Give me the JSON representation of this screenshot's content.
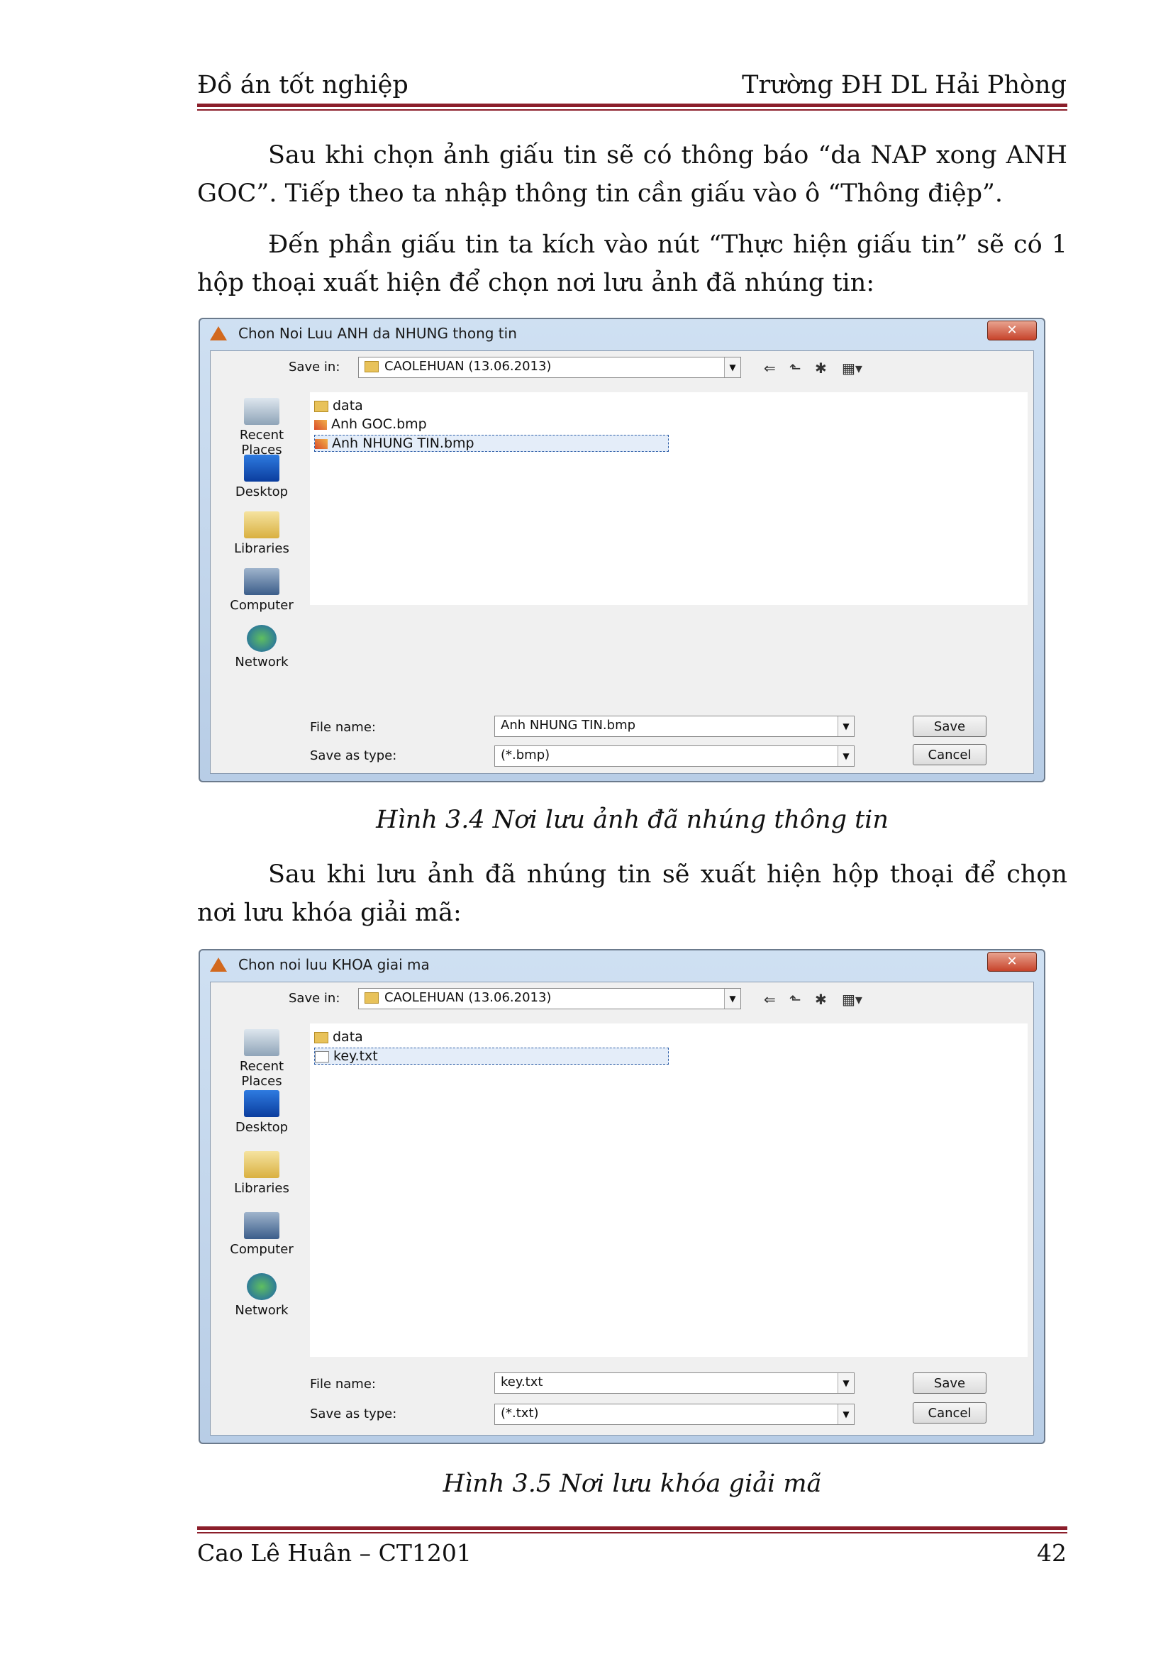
{
  "header": {
    "left": "Đồ án tốt nghiệp",
    "right": "Trường ĐH DL Hải Phòng"
  },
  "paragraphs": {
    "p1": "Sau khi chọn ảnh giấu tin sẽ có thông báo “da NAP xong ANH GOC”. Tiếp theo ta nhập thông tin cần giấu vào ô “Thông điệp”.",
    "p2": "Đến phần giấu tin ta kích vào nút “Thực hiện giấu tin” sẽ có 1 hộp thoại xuất hiện để chọn nơi lưu ảnh đã nhúng tin:",
    "p3": "Sau khi lưu ảnh đã nhúng tin sẽ xuất hiện hộp thoại để chọn nơi lưu khóa giải mã:"
  },
  "dialog1": {
    "title": "Chon Noi Luu ANH da NHUNG thong tin",
    "close": "✕",
    "save_in_label": "Save in:",
    "save_in_value": "CAOLEHUAN (13.06.2013)",
    "places": [
      "Recent Places",
      "Desktop",
      "Libraries",
      "Computer",
      "Network"
    ],
    "files": [
      "data",
      "Anh GOC.bmp",
      "Anh NHUNG TIN.bmp"
    ],
    "file_name_label": "File name:",
    "file_name_value": "Anh NHUNG TIN.bmp",
    "save_type_label": "Save as type:",
    "save_type_value": "(*.bmp)",
    "save_button": "Save",
    "cancel_button": "Cancel"
  },
  "caption1": "Hình 3.4 Nơi lưu ảnh đã nhúng thông tin",
  "dialog2": {
    "title": "Chon noi luu KHOA giai ma",
    "close": "✕",
    "save_in_label": "Save in:",
    "save_in_value": "CAOLEHUAN (13.06.2013)",
    "places": [
      "Recent Places",
      "Desktop",
      "Libraries",
      "Computer",
      "Network"
    ],
    "files": [
      "data",
      "key.txt"
    ],
    "file_name_label": "File name:",
    "file_name_value": "key.txt",
    "save_type_label": "Save as type:",
    "save_type_value": "(*.txt)",
    "save_button": "Save",
    "cancel_button": "Cancel"
  },
  "caption2": "Hình 3.5 Nơi lưu khóa giải mã",
  "footer": {
    "left": "Cao Lê Huân – CT1201",
    "page": "42"
  }
}
